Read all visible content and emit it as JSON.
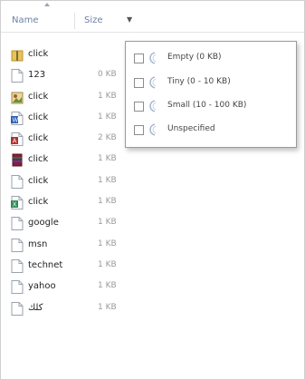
{
  "header": {
    "name_label": "Name",
    "size_label": "Size",
    "dropdown_glyph": "▼"
  },
  "files": [
    {
      "name": "click",
      "size": "",
      "icon": "folder-zip-icon"
    },
    {
      "name": "123",
      "size": "0 KB",
      "icon": "text-file-icon"
    },
    {
      "name": "click",
      "size": "1 KB",
      "icon": "image-file-icon"
    },
    {
      "name": "click",
      "size": "1 KB",
      "icon": "word-file-icon"
    },
    {
      "name": "click",
      "size": "2 KB",
      "icon": "access-file-icon"
    },
    {
      "name": "click",
      "size": "1 KB",
      "icon": "archive-file-icon"
    },
    {
      "name": "click",
      "size": "1 KB",
      "icon": "text-file-icon"
    },
    {
      "name": "click",
      "size": "1 KB",
      "icon": "excel-file-icon"
    },
    {
      "name": "google",
      "size": "1 KB",
      "icon": "text-file-icon"
    },
    {
      "name": "msn",
      "size": "1 KB",
      "icon": "text-file-icon"
    },
    {
      "name": "technet",
      "size": "1 KB",
      "icon": "text-file-icon"
    },
    {
      "name": "yahoo",
      "size": "1 KB",
      "icon": "text-file-icon"
    },
    {
      "name": "كلك",
      "size": "1 KB",
      "icon": "text-file-icon"
    }
  ],
  "size_filter": {
    "options": [
      {
        "label": "Empty (0 KB)",
        "checked": false
      },
      {
        "label": "Tiny (0 - 10 KB)",
        "checked": false
      },
      {
        "label": "Small (10 - 100 KB)",
        "checked": false
      },
      {
        "label": "Unspecified",
        "checked": false
      }
    ]
  },
  "colors": {
    "header_text": "#6e7fa6",
    "folder_yellow": "#e8c25a",
    "word_blue": "#2b5fb3",
    "access_red": "#b03030",
    "excel_green": "#2e8b57",
    "archive_maroon": "#8a1c3a"
  }
}
